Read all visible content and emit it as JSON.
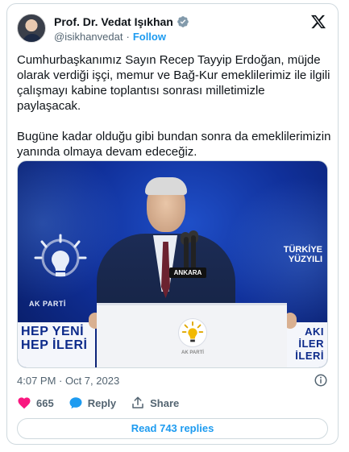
{
  "author": {
    "name": "Prof. Dr. Vedat Işıkhan",
    "handle": "@isikhanvedat",
    "separator": "·",
    "follow_label": "Follow"
  },
  "tweet": {
    "paragraphs": [
      "Cumhurbaşkanımız Sayın Recep Tayyip Erdoğan, müjde olarak verdiği işçi, memur ve Bağ-Kur emeklilerimiz ile ilgili çalışmayı kabine toplantısı sonrası milletimizle paylaşacak.",
      "Bugüne kadar olduğu gibi bundan sonra da emeklilerimizin yanında olmaya devam edeceğiz."
    ]
  },
  "media": {
    "podium_tag": "ANKARA",
    "left_logo_text": "AK PARTİ",
    "podium_logo_text": "AK PARTİ",
    "left_sign": {
      "small": "",
      "line1": "HEP YENİ",
      "line2": "HEP İLERİ"
    },
    "right_banner": {
      "line1": "TÜRKİYE",
      "line2": "YÜZYILI"
    },
    "right_sign": {
      "line1": "AKI",
      "line2": "İLER",
      "line3": "İLERİ"
    }
  },
  "meta": {
    "timestamp": "4:07 PM · Oct 7, 2023"
  },
  "actions": {
    "like_count": "665",
    "reply_label": "Reply",
    "share_label": "Share"
  },
  "read_replies_label": "Read 743 replies",
  "colors": {
    "accent": "#1d9bf0",
    "like": "#f91880",
    "muted": "#536471",
    "border": "#cfd9de"
  },
  "icons": {
    "verified": "verified-badge-icon",
    "x_logo": "x-logo-icon",
    "info": "info-icon",
    "like": "heart-icon",
    "reply": "speech-bubble-icon",
    "share": "share-upload-icon"
  }
}
